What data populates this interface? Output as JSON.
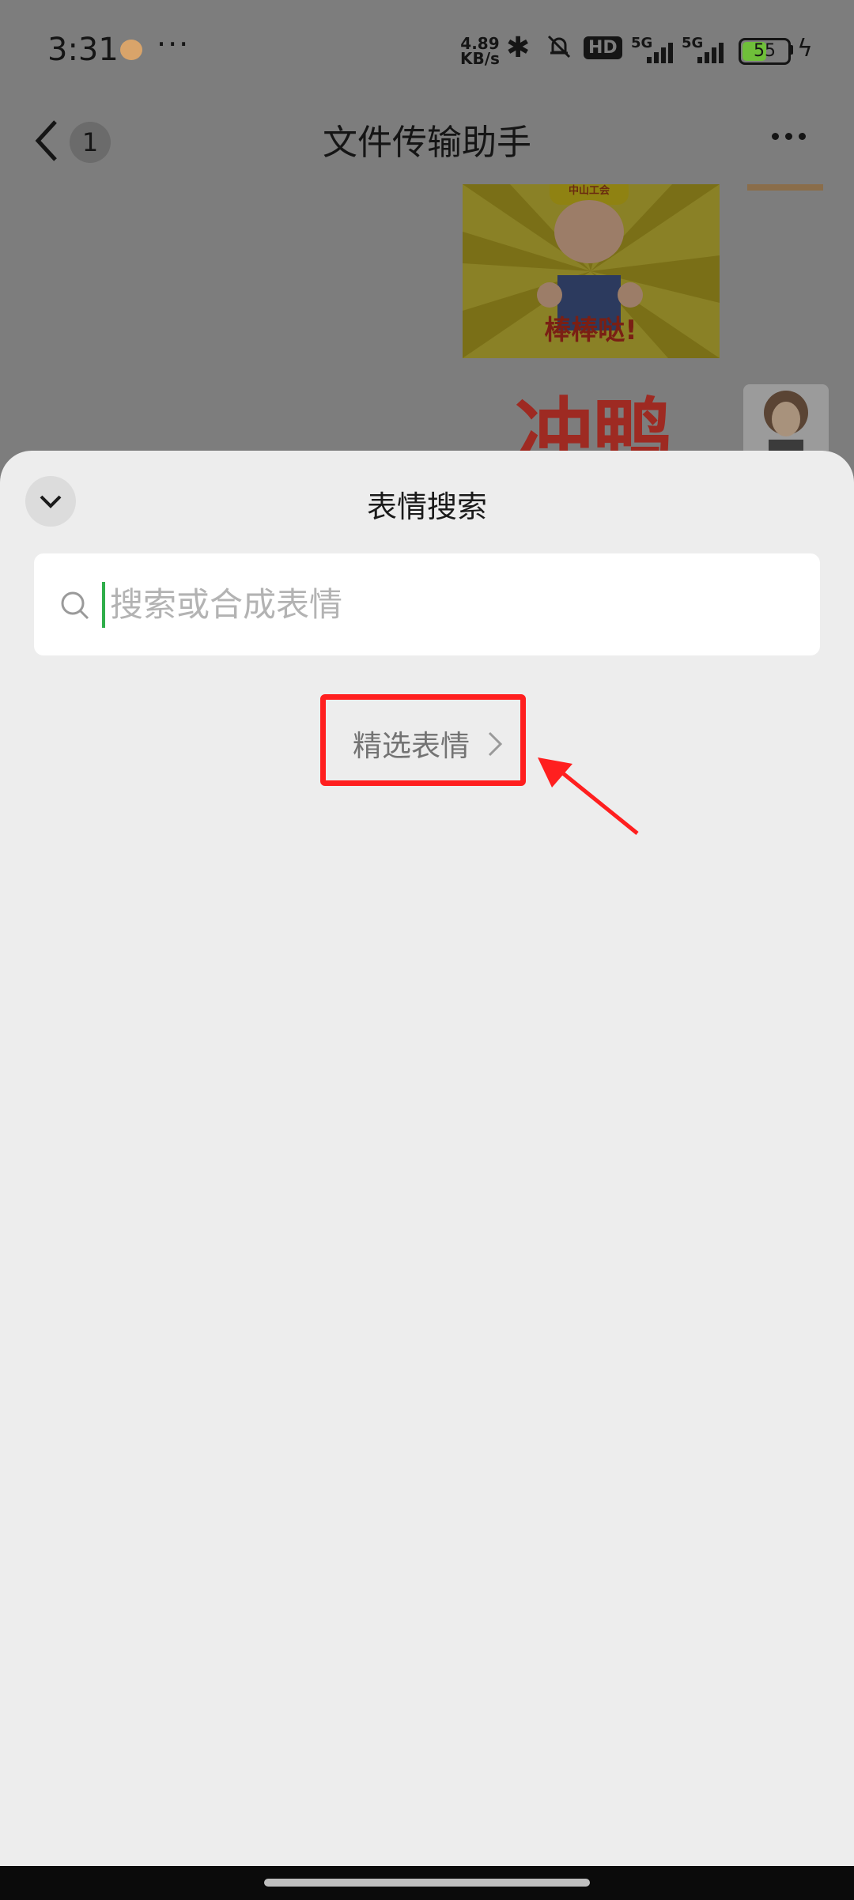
{
  "status_bar": {
    "time": "3:31",
    "net_speed_value": "4.89",
    "net_speed_unit": "KB/s",
    "hd_label": "HD",
    "signal_label_1": "5G",
    "signal_label_2": "5G",
    "battery": "55",
    "icons": [
      "app-icon",
      "more-icon",
      "bluetooth-icon",
      "mute-bell-icon",
      "hd-icon",
      "signal-icon",
      "battery-icon",
      "charging-icon"
    ]
  },
  "nav": {
    "title": "文件传输助手",
    "unread_count": "1",
    "icons": [
      "back-icon",
      "more-icon"
    ]
  },
  "chat": {
    "sticker1_text": "棒棒哒!",
    "sticker1_hat_text": "中山工会",
    "sticker2_text": "冲鸭"
  },
  "sheet": {
    "title": "表情搜索",
    "search_placeholder": "搜索或合成表情",
    "featured_label": "精选表情"
  },
  "colors": {
    "highlight": "#ff1f1f",
    "caret": "#2fae4a",
    "sheet_bg": "#ededed",
    "overlay_bg": "#7d7d7d"
  }
}
